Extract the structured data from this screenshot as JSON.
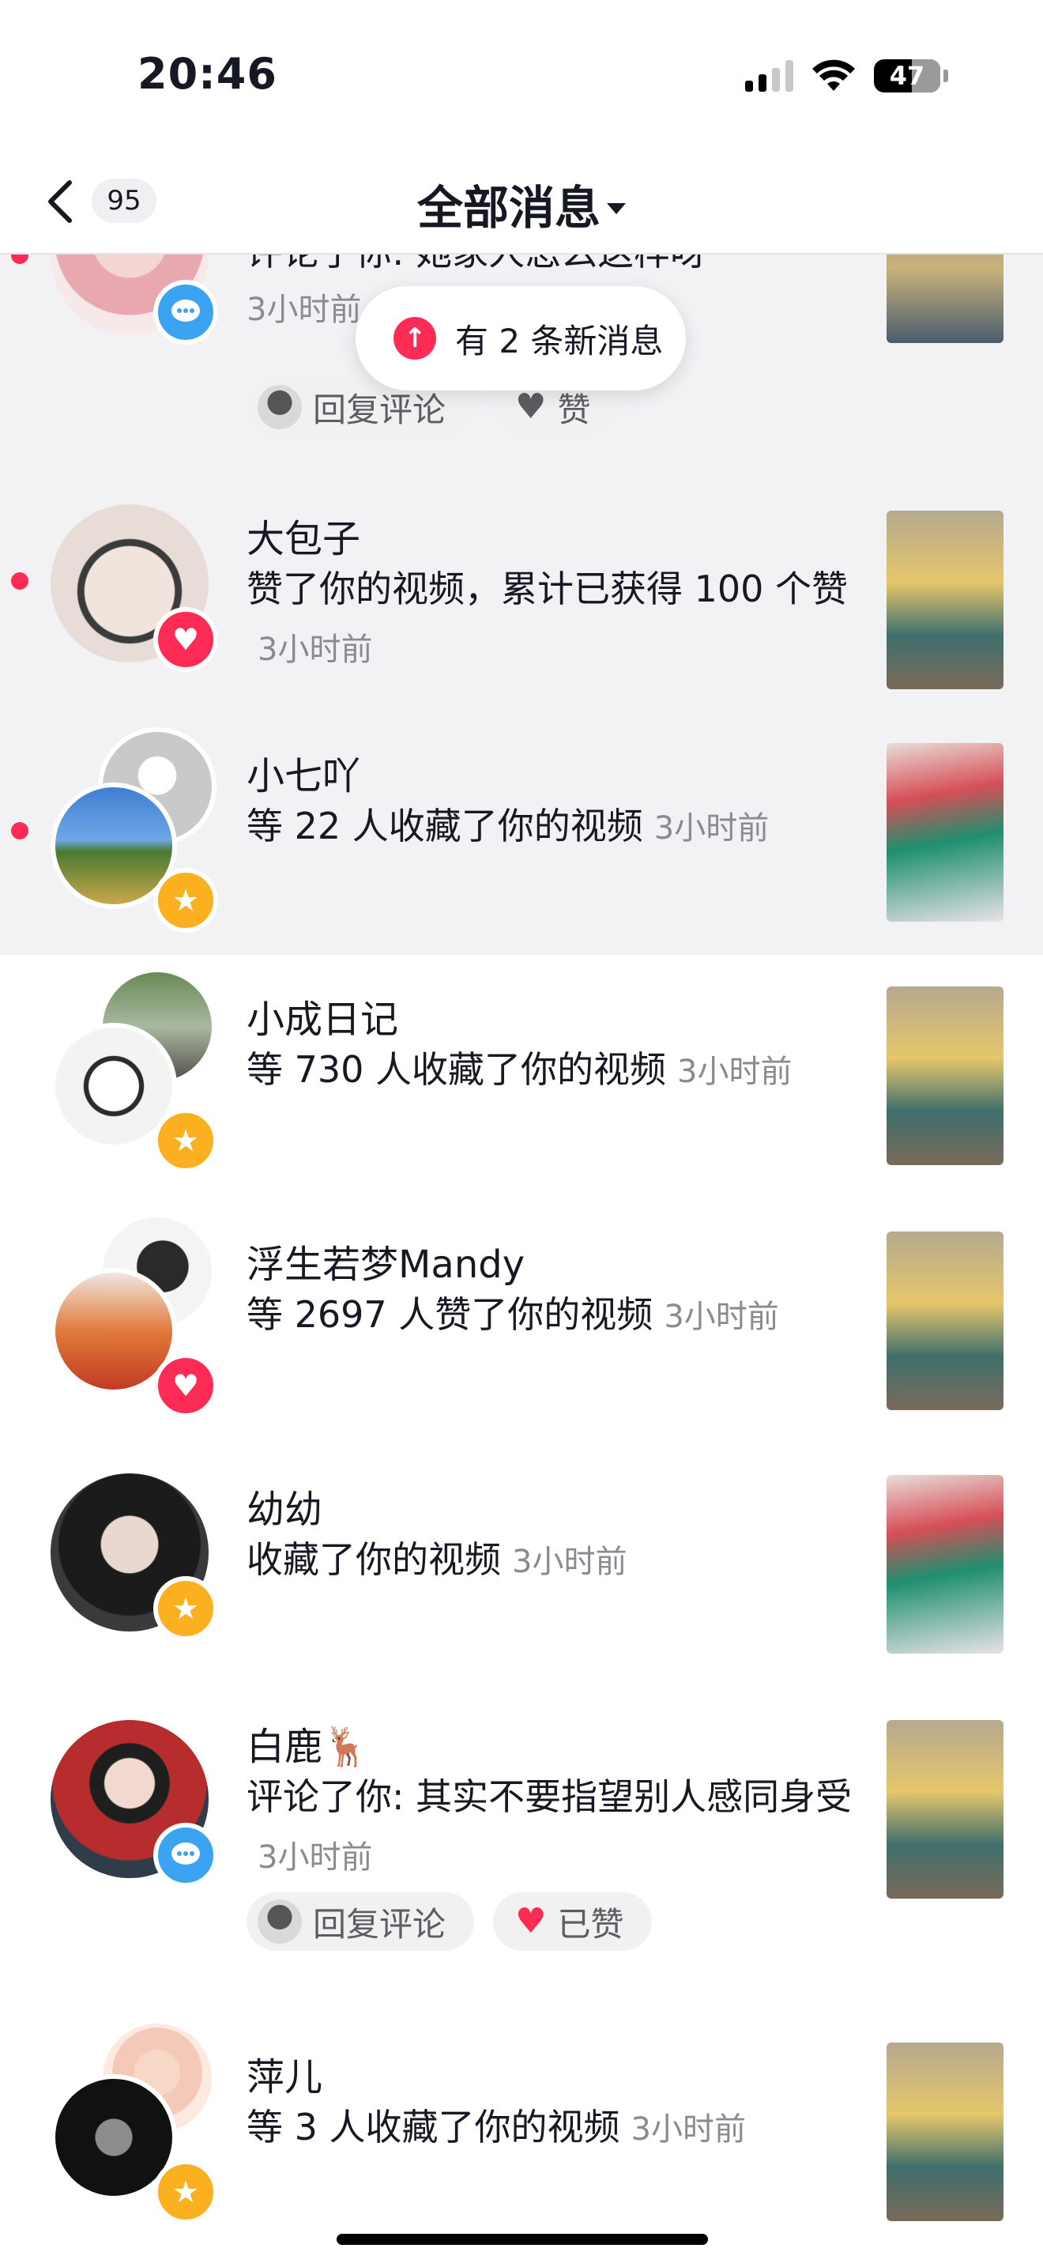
{
  "status_bar": {
    "time": "20:46",
    "battery": "47"
  },
  "nav": {
    "count": "95",
    "title": "全部消息"
  },
  "toast": {
    "text": "有 2 条新消息"
  },
  "items": [
    {
      "name": "",
      "text": "评论了你: 她家人怎么这样呀",
      "time": "3小时前",
      "badge": "comment",
      "actions": {
        "reply": "回复评论",
        "like": "赞"
      }
    },
    {
      "name": "大包子",
      "text": "赞了你的视频，累计已获得 100 个赞",
      "time": "3小时前",
      "badge": "like"
    },
    {
      "name": "小七吖",
      "text": "等 22 人收藏了你的视频",
      "time": "3小时前",
      "badge": "favorite"
    },
    {
      "name": "小成日记",
      "text": "等 730 人收藏了你的视频",
      "time": "3小时前",
      "badge": "favorite"
    },
    {
      "name": "浮生若梦Mandy",
      "text": "等 2697 人赞了你的视频",
      "time": "3小时前",
      "badge": "like"
    },
    {
      "name": "幼幼",
      "text": "收藏了你的视频",
      "time": "3小时前",
      "badge": "favorite"
    },
    {
      "name": "白鹿🦌",
      "text": "评论了你: 其实不要指望别人感同身受",
      "time": "3小时前",
      "badge": "comment",
      "actions": {
        "reply": "回复评论",
        "like": "已赞"
      }
    },
    {
      "name": "萍儿",
      "text": "等 3 人收藏了你的视频",
      "time": "3小时前",
      "badge": "favorite"
    }
  ],
  "colors": {
    "accent": "#fe2c55",
    "comment": "#3aa3f2",
    "favorite": "#fbb01f",
    "unread_bg": "#f2f2f5"
  }
}
